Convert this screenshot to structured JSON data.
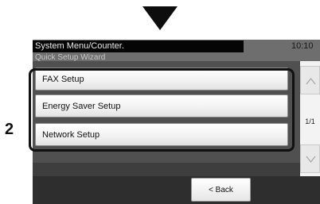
{
  "callout": {
    "number": "2"
  },
  "header": {
    "title": "System Menu/Counter.",
    "time": "10:10",
    "subtitle": "Quick Setup Wizard"
  },
  "menu": {
    "items": [
      {
        "label": "FAX Setup"
      },
      {
        "label": "Energy Saver Setup"
      },
      {
        "label": "Network Setup"
      }
    ]
  },
  "pager": {
    "indicator": "1/1"
  },
  "footer": {
    "back_label": "< Back"
  },
  "icons": {
    "down_arrow": "down-arrow-icon",
    "scroll_up": "chevron-up-icon",
    "scroll_down": "chevron-down-icon"
  }
}
